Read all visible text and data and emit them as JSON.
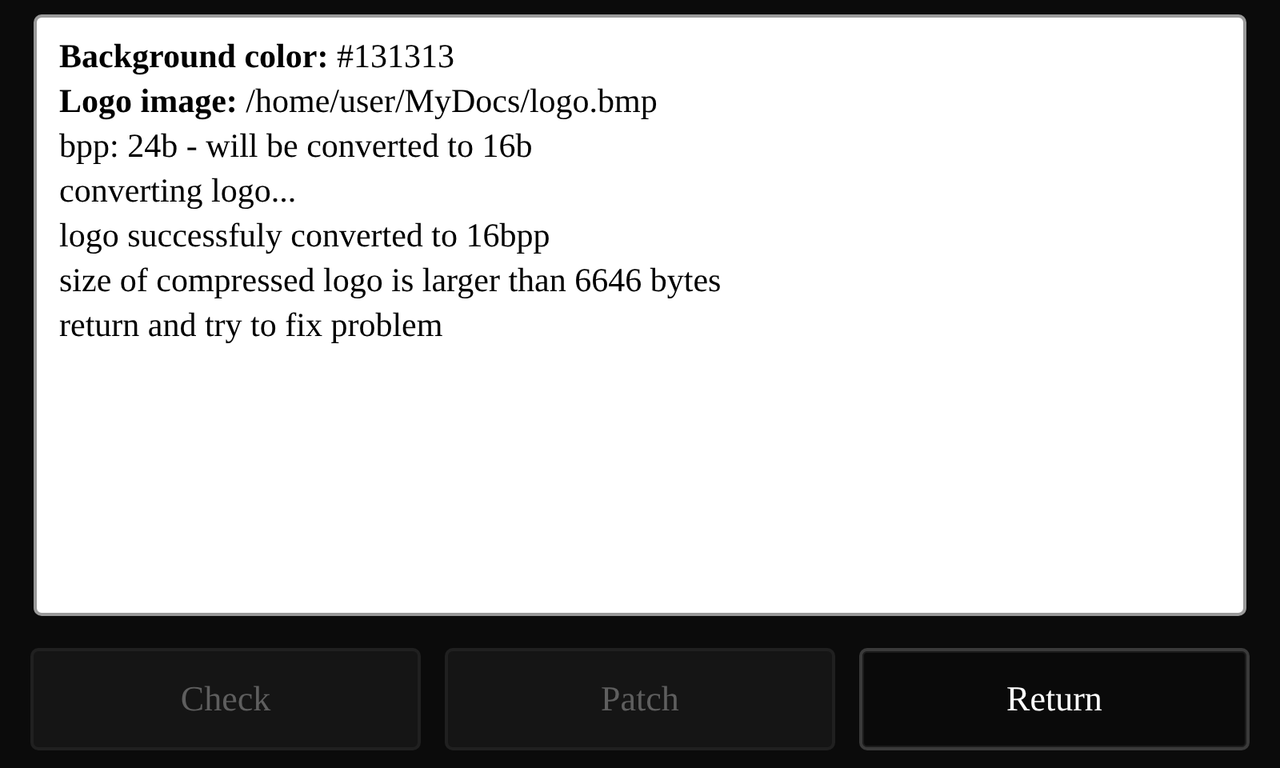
{
  "log": {
    "lines": [
      "**Background color:** #131313",
      "**Logo image:** /home/user/MyDocs/logo.bmp",
      "bpp: 24b - will be converted to 16b",
      "converting logo...",
      "logo successfuly converted to 16bpp",
      "size of compressed logo is larger than 6646 bytes",
      "return and try to fix problem"
    ]
  },
  "buttons": [
    {
      "label": "Check",
      "disabled": true
    },
    {
      "label": "Patch",
      "disabled": true
    },
    {
      "label": "Return",
      "disabled": false
    }
  ]
}
